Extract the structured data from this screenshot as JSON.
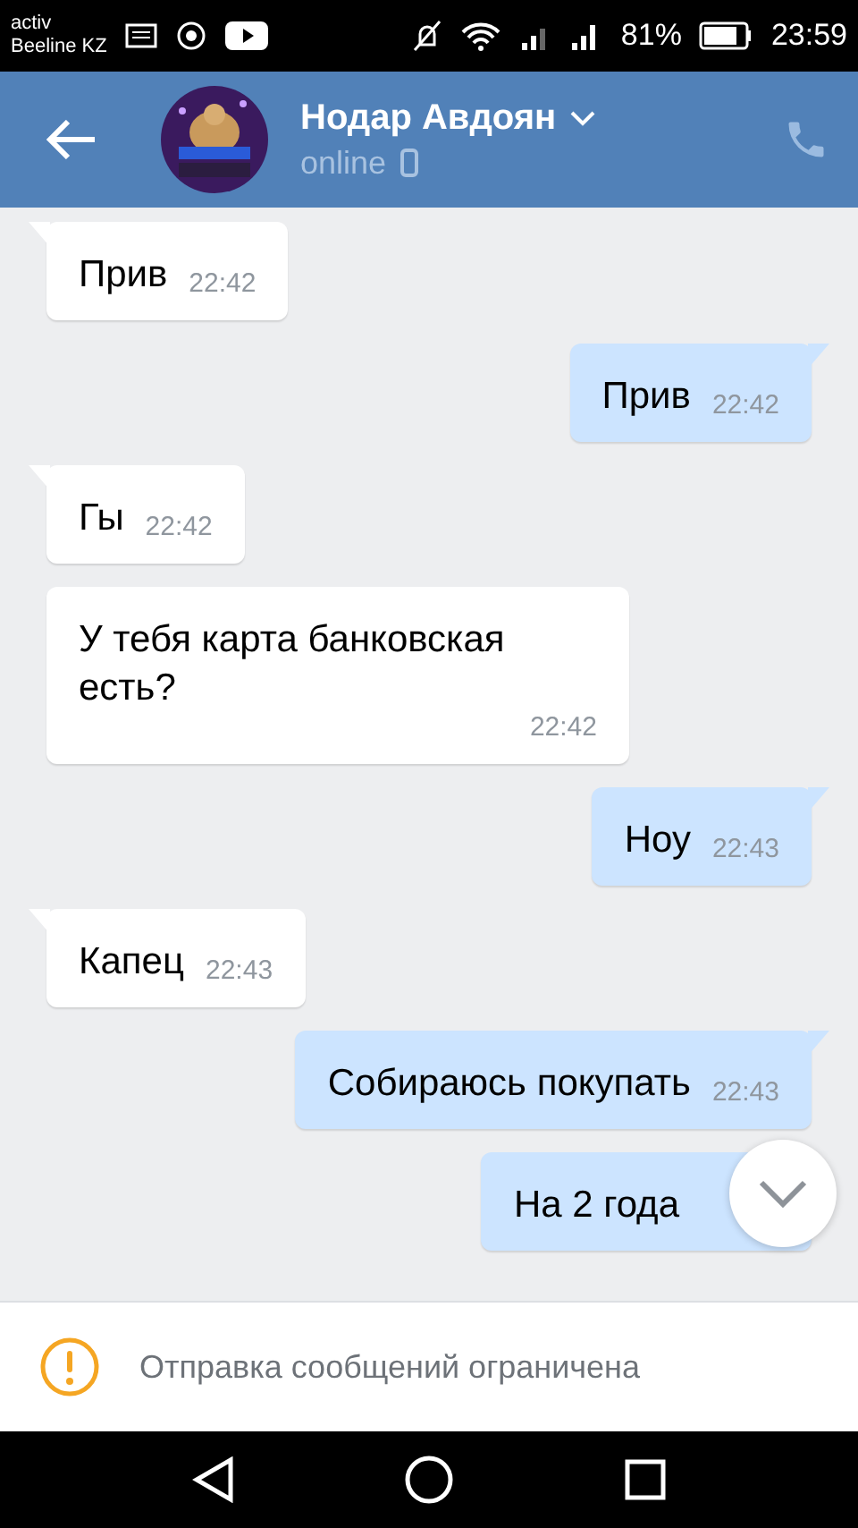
{
  "status_bar": {
    "carrier_lines": [
      "activ",
      "Beeline KZ"
    ],
    "battery": "81%",
    "time": "23:59"
  },
  "header": {
    "name": "Нодар Авдоян",
    "status": "online"
  },
  "messages": [
    {
      "kind": "incoming",
      "text": "Прив",
      "time": "22:42",
      "tail": true
    },
    {
      "kind": "outgoing",
      "text": "Прив",
      "time": "22:42",
      "tail": true
    },
    {
      "kind": "incoming",
      "text": "Гы",
      "time": "22:42",
      "tail": true
    },
    {
      "kind": "incoming",
      "text": "У тебя карта банковская есть?",
      "time": "22:42",
      "tail": false
    },
    {
      "kind": "outgoing",
      "text": "Ноу",
      "time": "22:43",
      "tail": true
    },
    {
      "kind": "incoming",
      "text": "Капец",
      "time": "22:43",
      "tail": true
    },
    {
      "kind": "outgoing",
      "text": "Собираюсь покупать",
      "time": "22:43",
      "tail": true
    },
    {
      "kind": "outgoing",
      "text": "На 2 года",
      "tail": false
    }
  ],
  "notice": {
    "text": "Отправка сообщений ограничена"
  }
}
